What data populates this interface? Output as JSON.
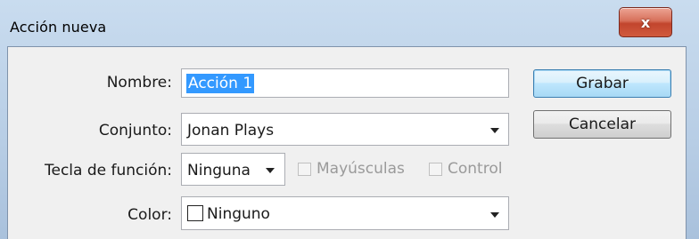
{
  "window": {
    "title": "Acción nueva",
    "close_label": "x"
  },
  "form": {
    "name_label": "Nombre:",
    "name_value": "Acción 1",
    "set_label": "Conjunto:",
    "set_value": "Jonan Plays",
    "function_key_label": "Tecla de función:",
    "function_key_value": "Ninguna",
    "shift_label": "Mayúsculas",
    "shift_checked": false,
    "control_label": "Control",
    "control_checked": false,
    "color_label": "Color:",
    "color_value": "Ninguno",
    "color_swatch": "#ffffff"
  },
  "buttons": {
    "record_label": "Grabar",
    "cancel_label": "Cancelar"
  },
  "icons": {
    "close": "close-icon",
    "dropdown": "chevron-down-icon"
  }
}
